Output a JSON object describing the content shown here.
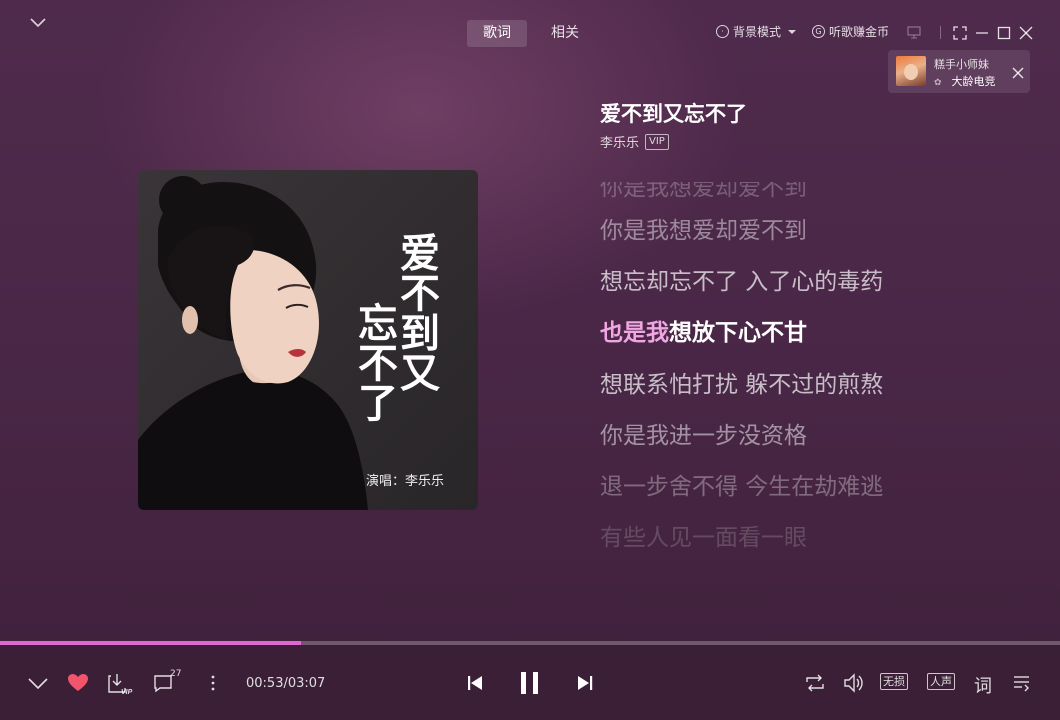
{
  "tabs": [
    {
      "label": "歌词",
      "active": true
    },
    {
      "label": "相关",
      "active": false
    }
  ],
  "toolbar": {
    "bg_mode_label": "背景模式",
    "earn_coins_label": "听歌赚金币"
  },
  "notification": {
    "title": "糕手小师妹",
    "subtitle": "大龄电竞",
    "subtitle_prefix": "✿"
  },
  "cover": {
    "title_line1": "爱不到又",
    "title_line2": "忘不了",
    "credit": "演唱：李乐乐"
  },
  "song": {
    "title": "爱不到又忘不了",
    "artist": "李乐乐",
    "badge": "VIP"
  },
  "lyrics": {
    "prev_partial": "你是我想爱却爱不到",
    "lines": [
      "你是我想爱却爱不到",
      "想忘却忘不了 入了心的毒药",
      "也是我想放下心不甘",
      "想联系怕打扰 躲不过的煎熬",
      "你是我进一步没资格",
      "退一步舍不得 今生在劫难逃",
      "有些人见一面看一眼"
    ],
    "active_index": 2,
    "active_sung": "也是我",
    "active_rest": "想放下心不甘"
  },
  "player": {
    "current_time": "00:53",
    "total_time": "03:07",
    "time_display": "00:53/03:07",
    "progress": 0.284,
    "comment_count": "27",
    "lossless_label": "无损",
    "vocal_label": "人声",
    "lyrics_label": "词"
  },
  "colors": {
    "accent": "#e067d1",
    "sung_lyric": "#f0a6e2",
    "heart": "#f2546b"
  }
}
